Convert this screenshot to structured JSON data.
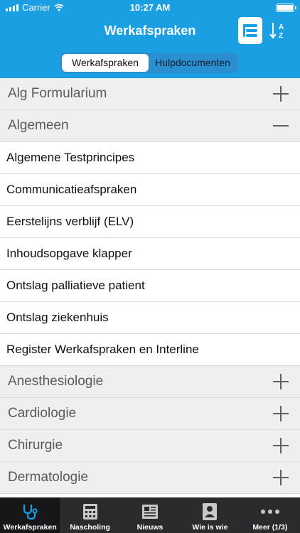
{
  "status": {
    "carrier": "Carrier",
    "time": "10:27 AM"
  },
  "nav": {
    "title": "Werkafspraken"
  },
  "segments": [
    "Werkafspraken",
    "Hulpdocumenten"
  ],
  "list": {
    "section1": "Alg Formularium",
    "section2": "Algemeen",
    "items": [
      "Algemene Testprincipes",
      "Communicatieafspraken",
      "Eerstelijns verblijf (ELV)",
      "Inhoudsopgave klapper",
      "Ontslag palliatieve patient",
      "Ontslag ziekenhuis",
      "Register Werkafspraken en Interline"
    ],
    "section3": "Anesthesiologie",
    "section4": "Cardiologie",
    "section5": "Chirurgie",
    "section6": "Dermatologie"
  },
  "tabs": [
    "Werkafspraken",
    "Nascholing",
    "Nieuws",
    "Wie is wie",
    "Meer (1/3)"
  ],
  "colors": {
    "accent": "#1a9fe3",
    "tabbar": "#2b2b2d",
    "tab_active_icon": "#1a9fe3"
  }
}
